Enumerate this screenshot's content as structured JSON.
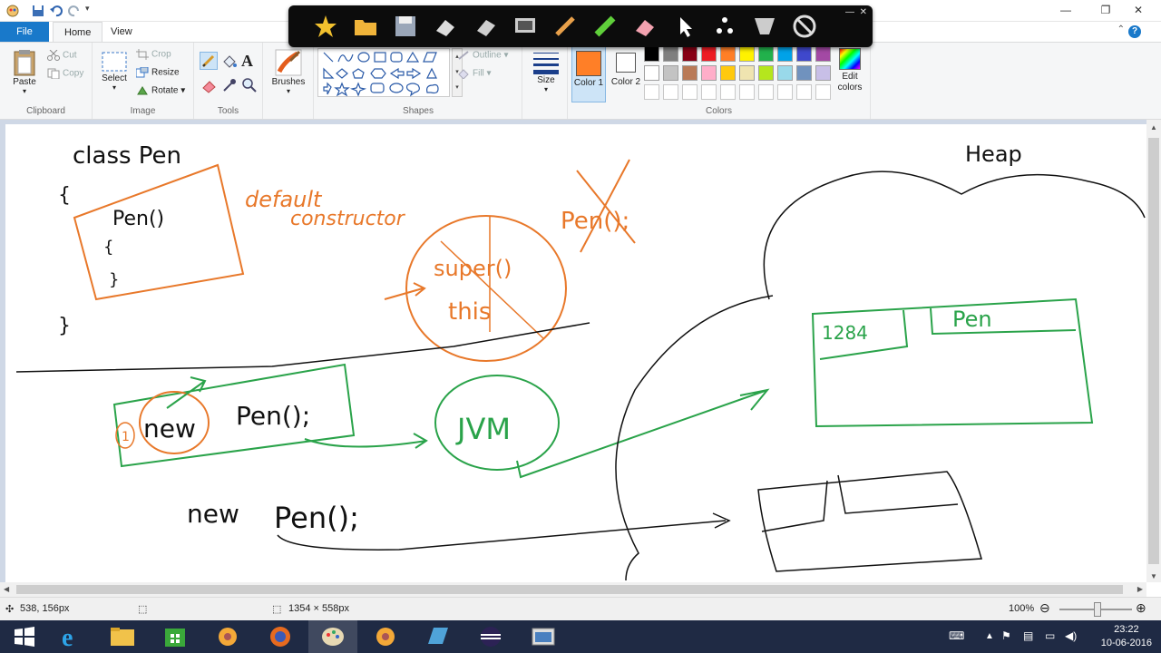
{
  "titlebar": {
    "minimize": "—",
    "maximize": "❐",
    "close": "✕"
  },
  "tabs": [
    {
      "label": "File"
    },
    {
      "label": "Home"
    },
    {
      "label": "View"
    }
  ],
  "ribbon": {
    "clipboard": {
      "group": "Clipboard",
      "paste": "Paste",
      "cut": "Cut",
      "copy": "Copy"
    },
    "image": {
      "group": "Image",
      "select": "Select",
      "crop": "Crop",
      "resize": "Resize",
      "rotate": "Rotate"
    },
    "tools": {
      "group": "Tools"
    },
    "brushes": {
      "label": "Brushes"
    },
    "shapes": {
      "group": "Shapes",
      "outline": "Outline",
      "fill": "Fill"
    },
    "size": {
      "label": "Size"
    },
    "colors": {
      "group": "Colors",
      "color1": "Color 1",
      "color2": "Color 2",
      "edit": "Edit colors",
      "color1_value": "#ff7f27",
      "color2_value": "#ffffff",
      "row1": [
        "#000000",
        "#7f7f7f",
        "#880015",
        "#ed1c24",
        "#ff7f27",
        "#fff200",
        "#22b14c",
        "#00a2e8",
        "#3f48cc",
        "#a349a4"
      ],
      "row2": [
        "#ffffff",
        "#c3c3c3",
        "#b97a57",
        "#ffaec9",
        "#ffc90e",
        "#efe4b0",
        "#b5e61d",
        "#99d9ea",
        "#7092be",
        "#c8bfe7"
      ]
    }
  },
  "drawing": {
    "class_header": "class Pen",
    "open_brace": "{",
    "close_brace": "}",
    "constructor": "Pen()",
    "ctor_open": "{",
    "ctor_close": "}",
    "default_constructor_1": "default",
    "default_constructor_2": "constructor",
    "crossed_call": "Pen();",
    "super_call": "super()",
    "this_word": "this",
    "new_label": "new",
    "new_call": "Pen();",
    "step_number": "1",
    "jvm": "JVM",
    "second_new": "new",
    "second_call": "Pen();",
    "heap": "Heap",
    "address": "1284",
    "object_class": "Pen"
  },
  "statusbar": {
    "cursor": "538, 156px",
    "canvas_size": "1354 × 558px",
    "zoom": "100%"
  },
  "taskbar": {
    "time": "23:22",
    "date": "10-06-2016"
  }
}
